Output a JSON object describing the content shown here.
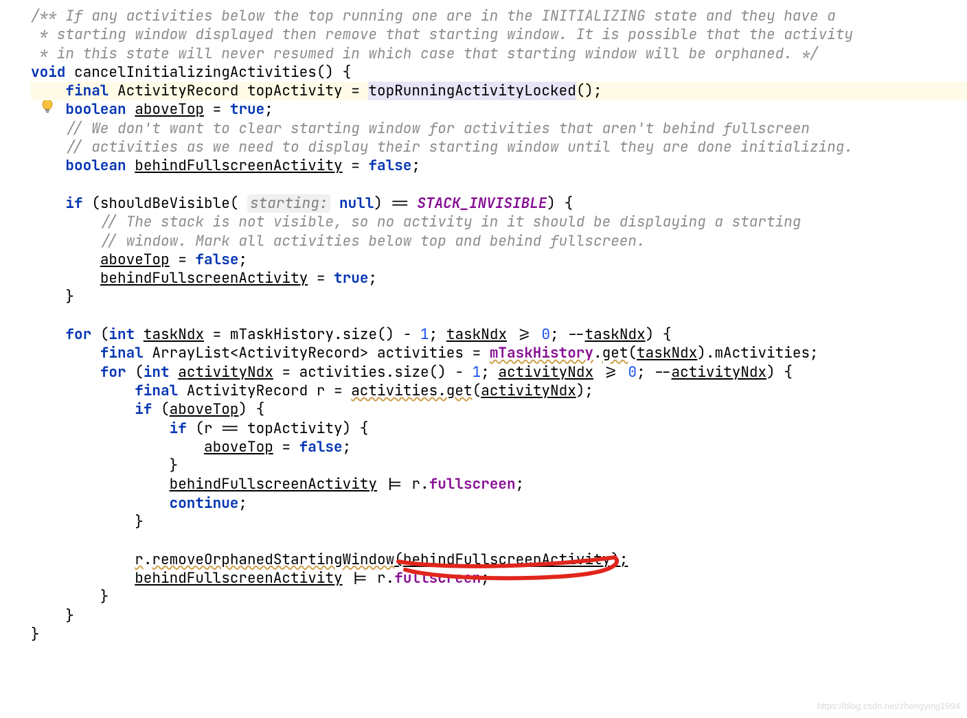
{
  "gutter": {
    "intention_icon": "bulb-icon"
  },
  "code": {
    "lines": [
      {
        "type": "cmt",
        "text": "/** If any activities below the top running one are in the INITIALIZING state and they have a "
      },
      {
        "type": "cmt",
        "text": " * starting window displayed then remove that starting window. It is possible that the activity "
      },
      {
        "type": "cmt",
        "text": " * in this state will never resumed in which case that starting window will be orphaned. */"
      },
      {
        "type": "sig",
        "kw1": "void",
        "name": " cancelInitializingActivities() {"
      },
      {
        "type": "decl-call",
        "indent": "    ",
        "kw": "final",
        "rest1": " ActivityRecord topActivity = ",
        "call": "topRunningActivityLocked",
        "rest2": "();",
        "hl": true
      },
      {
        "type": "decl-bool",
        "indent": "    ",
        "kw": "boolean",
        "name": "aboveTop",
        "eq": " = ",
        "val": "true",
        "tail": ";"
      },
      {
        "type": "cmt-indent",
        "indent": "    ",
        "text": "// We don't want to clear starting window for activities that aren't behind fullscreen "
      },
      {
        "type": "cmt-indent",
        "indent": "    ",
        "text": "// activities as we need to display their starting window until they are done initializing."
      },
      {
        "type": "decl-bool",
        "indent": "    ",
        "kw": "boolean",
        "name": "behindFullscreenActivity",
        "eq": " = ",
        "val": "false",
        "tail": ";"
      },
      {
        "type": "blank"
      },
      {
        "type": "if-should",
        "indent": "    ",
        "kw": "if",
        "open": " (shouldBeVisible( ",
        "param": "starting:",
        "nullkw": " null",
        "mid": ") == ",
        "constv": "STACK_INVISIBLE",
        "tail": ") {"
      },
      {
        "type": "cmt-indent",
        "indent": "        ",
        "text": "// The stack is not visible, so no activity in it should be displaying a starting "
      },
      {
        "type": "cmt-indent",
        "indent": "        ",
        "text": "// window. Mark all activities below top and behind fullscreen."
      },
      {
        "type": "assign",
        "indent": "        ",
        "name": "aboveTop",
        "eq": " = ",
        "val": "false",
        "tail": ";"
      },
      {
        "type": "assign",
        "indent": "        ",
        "name": "behindFullscreenActivity",
        "eq": " = ",
        "val": "true",
        "tail": ";"
      },
      {
        "type": "plain",
        "indent": "    ",
        "text": "}"
      },
      {
        "type": "blank"
      },
      {
        "type": "for-outer",
        "indent": "    ",
        "kw1": "for",
        "p1": " (",
        "kw2": "int",
        "sp": " ",
        "var": "taskNdx",
        "p2": " = mTaskHistory.size() - ",
        "n1": "1",
        "p3": "; ",
        "var2": "taskNdx",
        "p4": " >= ",
        "n2": "0",
        "p5": "; --",
        "var3": "taskNdx",
        "p6": ") {"
      },
      {
        "type": "decl-arr",
        "indent": "        ",
        "kw": "final",
        "p1": " ArrayList<ActivityRecord> activities = ",
        "fld": "mTaskHistory",
        "dot": ".",
        "m": "get",
        "p2": "(",
        "arg": "taskNdx",
        "p3": ").mActivities;"
      },
      {
        "type": "for-inner",
        "indent": "        ",
        "kw1": "for",
        "p1": " (",
        "kw2": "int",
        "sp": " ",
        "var": "activityNdx",
        "p2": " = activities.size() - ",
        "n1": "1",
        "p3": "; ",
        "var2": "activityNdx",
        "p4": " >= ",
        "n2": "0",
        "p5": "; --",
        "var3": "activityNdx",
        "p6": ") {"
      },
      {
        "type": "decl-r",
        "indent": "            ",
        "kw": "final",
        "p1": " ActivityRecord r = ",
        "m": "activities.get",
        "p2": "(",
        "arg": "activityNdx",
        "p3": ");"
      },
      {
        "type": "if-simple",
        "indent": "            ",
        "kw": "if",
        "p1": " (",
        "var": "aboveTop",
        "p2": ") {"
      },
      {
        "type": "if-eq",
        "indent": "                ",
        "kw": "if",
        "p1": " (r == topActivity) {"
      },
      {
        "type": "assign",
        "indent": "                    ",
        "name": "aboveTop",
        "eq": " = ",
        "val": "false",
        "tail": ";"
      },
      {
        "type": "plain",
        "indent": "                ",
        "text": "}"
      },
      {
        "type": "oreq",
        "indent": "                ",
        "name": "behindFullscreenActivity",
        "p1": " |= r.",
        "fld": "fullscreen",
        "tail": ";"
      },
      {
        "type": "kw-stmt",
        "indent": "                ",
        "kw": "continue",
        "tail": ";"
      },
      {
        "type": "plain",
        "indent": "            ",
        "text": "}"
      },
      {
        "type": "blank"
      },
      {
        "type": "call-rm",
        "indent": "            ",
        "obj": "r",
        "dot": ".",
        "m": "removeOrphanedStartingWindow",
        "p1": "(",
        "arg": "behindFullscreenActivity",
        "p2": ");"
      },
      {
        "type": "oreq",
        "indent": "            ",
        "name": "behindFullscreenActivity",
        "p1": " |= r.",
        "fld": "fullscreen",
        "tail": ";"
      },
      {
        "type": "plain",
        "indent": "        ",
        "text": "}"
      },
      {
        "type": "plain",
        "indent": "    ",
        "text": "}"
      },
      {
        "type": "plain",
        "indent": "",
        "text": "}"
      }
    ]
  },
  "watermark": "https://blog.csdn.net/zhengying1994"
}
